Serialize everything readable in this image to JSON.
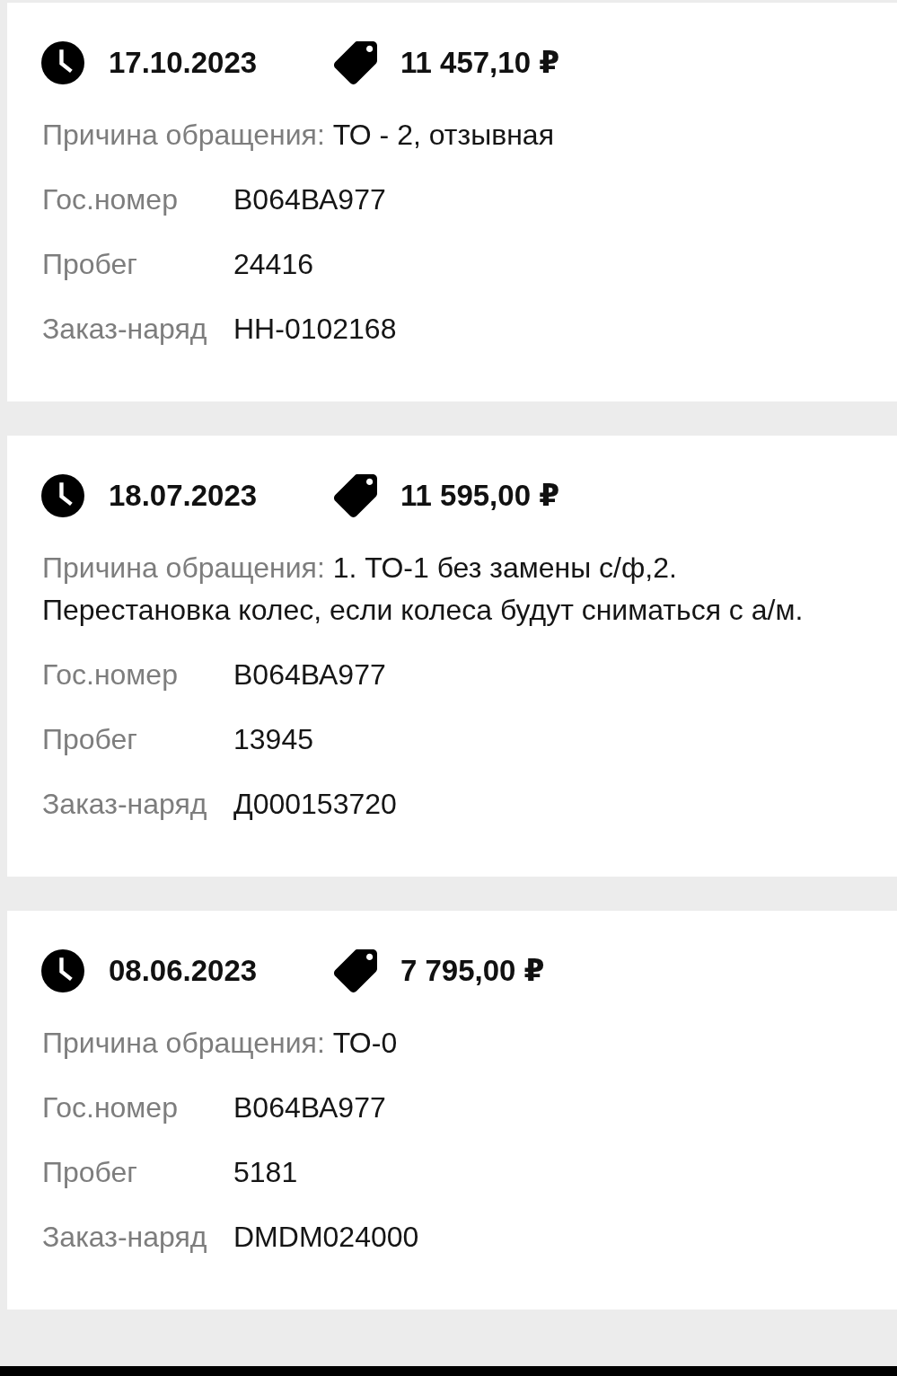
{
  "visits": [
    {
      "date": "17.10.2023",
      "price": "11 457,10 ₽",
      "reason_label": "Причина обращения:",
      "reason": "ТО - 2, отзывная",
      "fields": [
        {
          "label": "Гос.номер",
          "value": "В064ВА977"
        },
        {
          "label": "Пробег",
          "value": "24416"
        },
        {
          "label": "Заказ-наряд",
          "value": "НН-0102168"
        }
      ]
    },
    {
      "date": "18.07.2023",
      "price": "11 595,00 ₽",
      "reason_label": "Причина обращения:",
      "reason": "1. ТО-1 без замены с/ф,2. Перестановка колес, если колеса будут сниматься с а/м.",
      "fields": [
        {
          "label": "Гос.номер",
          "value": "В064ВА977"
        },
        {
          "label": "Пробег",
          "value": "13945"
        },
        {
          "label": "Заказ-наряд",
          "value": "Д000153720"
        }
      ]
    },
    {
      "date": "08.06.2023",
      "price": "7 795,00 ₽",
      "reason_label": "Причина обращения:",
      "reason": "ТО-0",
      "fields": [
        {
          "label": "Гос.номер",
          "value": "В064ВА977"
        },
        {
          "label": "Пробег",
          "value": "5181"
        },
        {
          "label": "Заказ-наряд",
          "value": "DMDM024000"
        }
      ]
    }
  ]
}
